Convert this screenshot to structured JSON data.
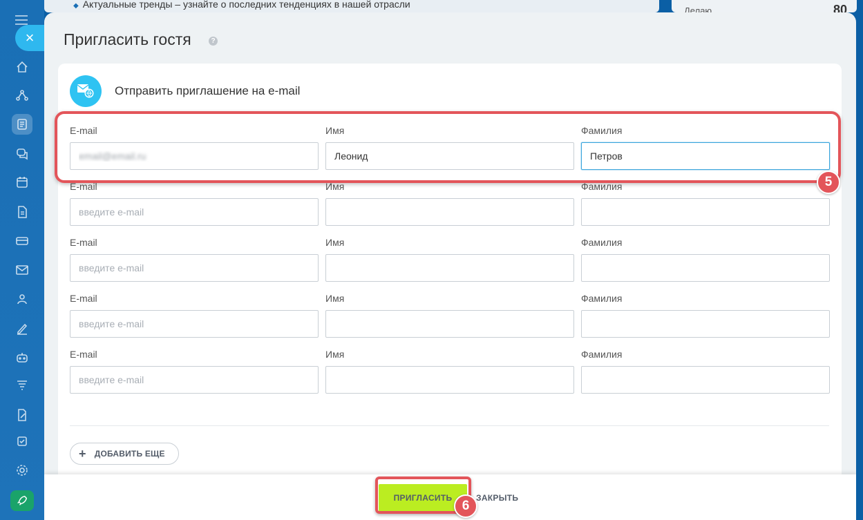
{
  "background": {
    "top_text": "Актуальные тренды – узнайте о последних тенденциях в нашей отрасли",
    "right_label": "Делаю",
    "right_value": "80"
  },
  "modal": {
    "title": "Пригласить гостя",
    "help_icon_text": "?",
    "section_title": "Отправить приглашение на e-mail",
    "labels": {
      "email": "E-mail",
      "first_name": "Имя",
      "last_name": "Фамилия"
    },
    "email_placeholder": "введите e-mail",
    "rows": [
      {
        "email": "email@email.ru",
        "first_name": "Леонид",
        "last_name": "Петров"
      },
      {
        "email": "",
        "first_name": "",
        "last_name": ""
      },
      {
        "email": "",
        "first_name": "",
        "last_name": ""
      },
      {
        "email": "",
        "first_name": "",
        "last_name": ""
      },
      {
        "email": "",
        "first_name": "",
        "last_name": ""
      }
    ],
    "add_more_label": "ДОБАВИТЬ ЕЩЕ",
    "invite_label": "ПРИГЛАСИТЬ",
    "close_label": "ЗАКРЫТЬ"
  },
  "annotations": {
    "step_rows": "5",
    "step_invite": "6"
  },
  "colors": {
    "accent_red": "#e3555a",
    "invite_green": "#bbed21",
    "icon_blue": "#2fc3f2"
  },
  "icons": {
    "sidebar": [
      "home-icon",
      "network-icon",
      "feed-icon",
      "chat-icon",
      "calendar-icon",
      "document-icon",
      "drive-icon",
      "mail-icon",
      "contacts-icon",
      "sign-icon",
      "robot-icon",
      "filter-icon",
      "edit-icon",
      "tasks-icon",
      "settings-icon",
      "rocket-icon"
    ]
  }
}
